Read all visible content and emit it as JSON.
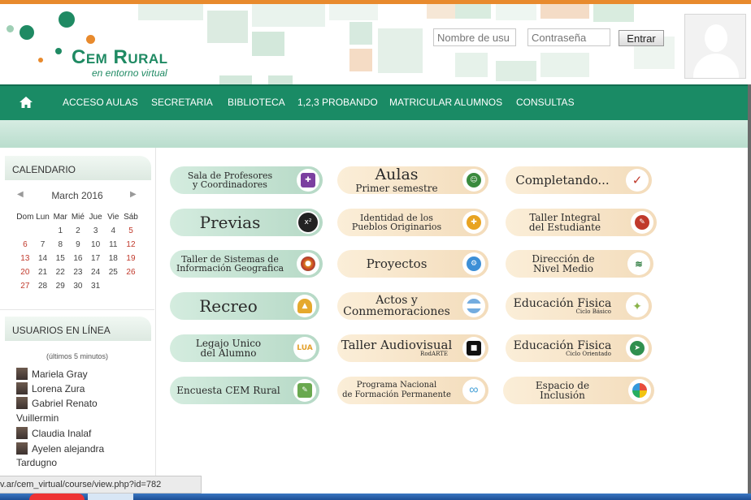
{
  "header": {
    "logo_title": "Cem Rural",
    "logo_subtitle": "en entorno virtual",
    "username_placeholder": "Nombre de usu",
    "password_placeholder": "Contraseña",
    "login_button": "Entrar"
  },
  "nav": {
    "items": [
      "ACCESO AULAS",
      "SECRETARIA",
      "BIBLIOTECA",
      "1,2,3 PROBANDO",
      "MATRICULAR ALUMNOS",
      "CONSULTAS"
    ]
  },
  "calendar": {
    "heading": "CALENDARIO",
    "month": "March 2016",
    "weekdays": [
      "Dom",
      "Lun",
      "Mar",
      "Mié",
      "Jue",
      "Vie",
      "Sáb"
    ],
    "weeks": [
      [
        "",
        "",
        "1",
        "2",
        "3",
        "4",
        "5"
      ],
      [
        "6",
        "7",
        "8",
        "9",
        "10",
        "11",
        "12"
      ],
      [
        "13",
        "14",
        "15",
        "16",
        "17",
        "18",
        "19"
      ],
      [
        "20",
        "21",
        "22",
        "23",
        "24",
        "25",
        "26"
      ],
      [
        "27",
        "28",
        "29",
        "30",
        "31",
        "",
        ""
      ]
    ]
  },
  "online_users": {
    "heading": "USUARIOS EN LÍNEA",
    "note": "(últimos 5 minutos)",
    "users": [
      "Mariela Gray",
      "Lorena Zura",
      "Gabriel Renato",
      "Vuillermin",
      "Claudia Inalaf",
      "Ayelen alejandra",
      "Tardugno"
    ]
  },
  "status_url": "v.ar/cem_virtual/course/view.php?id=782",
  "courses": [
    {
      "l1": "Sala de Profesores",
      "l2": "y Coordinadores",
      "l3": "",
      "color": "green",
      "icon": "puzzle-icon"
    },
    {
      "l1": "Aulas",
      "l2": "Primer semestre",
      "l3": "",
      "color": "peach",
      "icon": "student-icon"
    },
    {
      "l1": "Completando...",
      "l2": "",
      "l3": "",
      "color": "peach",
      "icon": "check-icon"
    },
    {
      "l1": "Previas",
      "l2": "",
      "l3": "",
      "color": "green",
      "icon": "math-icon"
    },
    {
      "l1": "Identidad de los",
      "l2": "Pueblos Originarios",
      "l3": "",
      "color": "peach",
      "icon": "emblem-icon"
    },
    {
      "l1": "Taller Integral",
      "l2": "del Estudiante",
      "l3": "",
      "color": "peach",
      "icon": "reading-icon"
    },
    {
      "l1": "Taller de Sistemas de",
      "l2": "Información Geografica",
      "l3": "",
      "color": "green",
      "icon": "globe-icon"
    },
    {
      "l1": "Proyectos",
      "l2": "",
      "l3": "",
      "color": "peach",
      "icon": "gear-icon"
    },
    {
      "l1": "Dirección de",
      "l2": "Nivel Medio",
      "l3": "",
      "color": "peach",
      "icon": "logo-icon"
    },
    {
      "l1": "Recreo",
      "l2": "",
      "l3": "",
      "color": "green",
      "icon": "bell-icon"
    },
    {
      "l1": "Actos y",
      "l2": "Conmemoraciones",
      "l3": "",
      "color": "peach",
      "icon": "flag-icon"
    },
    {
      "l1": "Educación Fisica",
      "l2": "",
      "l3": "Ciclo Básico",
      "color": "peach",
      "icon": "athlete-icon"
    },
    {
      "l1": "Legajo Unico",
      "l2": "del Alumno",
      "l3": "",
      "color": "green",
      "icon": "lua-icon",
      "icon_text": "LUA"
    },
    {
      "l1": "Taller Audiovisual",
      "l2": "",
      "l3": "RodARTE",
      "color": "peach",
      "icon": "camera-icon"
    },
    {
      "l1": "Educación Fisica",
      "l2": "",
      "l3": "Ciclo Orientado",
      "color": "peach",
      "icon": "runner-icon"
    },
    {
      "l1": "Encuesta CEM Rural",
      "l2": "",
      "l3": "",
      "color": "green",
      "icon": "survey-icon"
    },
    {
      "l1": "Programa Nacional",
      "l2": "de Formación Permanente",
      "l3": "",
      "color": "peach",
      "icon": "infinity-icon"
    },
    {
      "l1": "Espacio de",
      "l2": "Inclusión",
      "l3": "",
      "color": "peach",
      "icon": "people-circle-icon"
    }
  ],
  "colors": {
    "nav_green": "#1a8b65",
    "logo_green": "#1f8a63",
    "logo_orange": "#e88a2d",
    "pill_green": "#c6e3d3",
    "pill_peach": "#f6e4c8"
  }
}
